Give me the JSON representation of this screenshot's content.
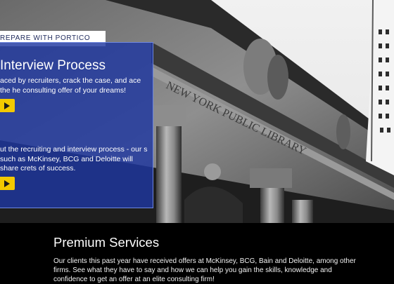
{
  "hero": {
    "tag": "REPARE WITH PORTICO",
    "title": "Interview Process",
    "para1": "aced by recruiters, crack the case, and ace the he consulting offer of your dreams!",
    "para2": "ut the recruiting and interview process - our s such as McKinsey, BCG and Deloitte will share crets of success.",
    "play_icon": "play-icon"
  },
  "services": {
    "title": "Premium Services",
    "text": "Our clients this past year have received offers at McKinsey, BCG, Bain and Deloitte, among other firms. See what they have to say and how we can help you gain the skills, knowledge and confidence to get an offer at an elite consulting firm!"
  },
  "colors": {
    "panel": "#1f37a0",
    "accent": "#f3c900",
    "tag_text": "#1f2a5c"
  }
}
